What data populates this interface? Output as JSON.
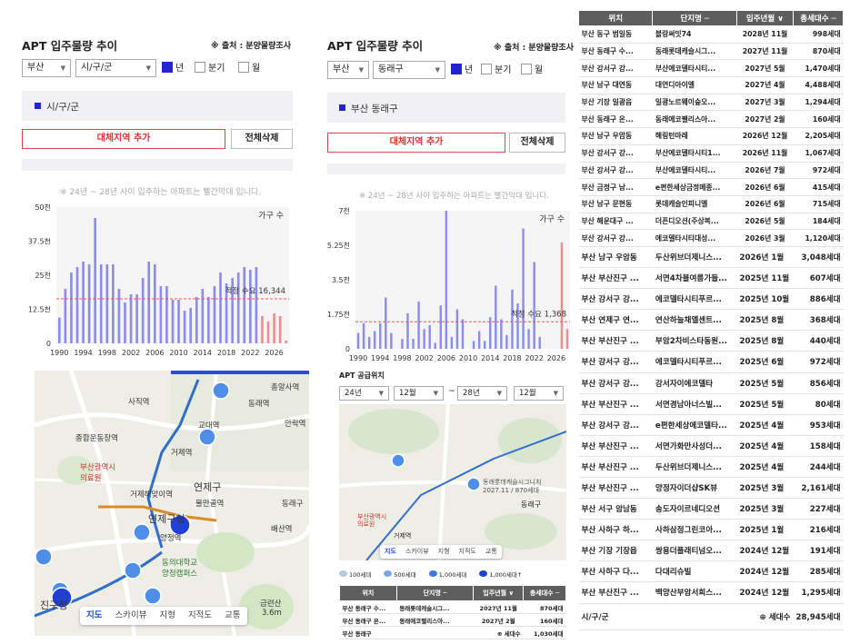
{
  "left": {
    "title": "APT 입주물량 추이",
    "source": "※ 출처 : 분양물량조사",
    "region_select": "부산",
    "district_select": "시/구/군",
    "period": [
      "년",
      "분기",
      "월"
    ],
    "region_label": "시/구/군",
    "add_button": "대체지역 추가",
    "delete_button": "전체삭제",
    "note": "※ 24년 ~ 28년 사이 입주하는 아파트는 빨간막대 입니다.",
    "map": {
      "labels": [
        "사직역",
        "동래역",
        "총알사역",
        "교대역",
        "안락역",
        "종합운동장역",
        "거제역",
        "부산광역시\n의료원",
        "거제해맞이역",
        "연제구",
        "물만골역",
        "동래구",
        "연제구청",
        "배산역",
        "양정역",
        "동의대학교\n양정캠퍼스",
        "진구청",
        "금련산"
      ],
      "tabs": [
        "지도",
        "스카이뷰",
        "지형",
        "지적도",
        "교통"
      ],
      "scale": "3.6m"
    }
  },
  "mid": {
    "title": "APT 입주물량 추이",
    "source": "※ 출처 : 분양물량조사",
    "region_select": "부산",
    "district_select": "동래구",
    "period": [
      "년",
      "분기",
      "월"
    ],
    "region_label": "부산 동래구",
    "add_button": "대체지역 추가",
    "delete_button": "전체삭제",
    "note": "※ 24년 ~ 28년 사이 입주하는 아파트는 빨간막대 입니다.",
    "supply_title": "APT 공급위치",
    "range": {
      "from_year": "24년",
      "from_month": "12월",
      "to_year": "28년",
      "to_month": "12월",
      "sep": "~"
    },
    "map": {
      "popup": "동래롯데캐슬시그니처\n2027.11 / 870세대",
      "labels": [
        "동래구",
        "부산광역시\n의료원",
        "거제역"
      ],
      "tabs": [
        "지도",
        "스카이뷰",
        "지형",
        "지적도",
        "교통"
      ]
    },
    "legend": [
      "100세대",
      "500세대",
      "1,000세대",
      "1,000세대↑"
    ],
    "table": {
      "headers": [
        "위치",
        "단지명 ─",
        "입주년월 ∨",
        "총세대수 ─"
      ],
      "rows": [
        [
          "부산 동래구 수...",
          "동래롯데캐슬시그...",
          "2027년 11월",
          "870세대"
        ],
        [
          "부산 동래구 온...",
          "동래에코팰리스아...",
          "2027년 2월",
          "160세대"
        ]
      ],
      "total": [
        "부산 동래구",
        "",
        "⊕ 세대수",
        "1,030세대"
      ]
    }
  },
  "right": {
    "headers": [
      "위치",
      "단지명 ─",
      "입주년월 ∨",
      "총세대수 ─"
    ],
    "rows": [
      [
        "부산 동구 범일동",
        "블랑써밋74",
        "2028년 11월",
        "998세대"
      ],
      [
        "부산 동래구 수...",
        "동래롯데캐슬시그...",
        "2027년 11월",
        "870세대"
      ],
      [
        "부산 강서구 강...",
        "부산에코델타시티...",
        "2027년 5월",
        "1,470세대"
      ],
      [
        "부산 남구 대연동",
        "대연디아이엘",
        "2027년 4월",
        "4,488세대"
      ],
      [
        "부산 기장 일광읍",
        "일광노르웨이숲오...",
        "2027년 3월",
        "1,294세대"
      ],
      [
        "부산 동래구 온...",
        "동래에코팰리스아...",
        "2027년 2월",
        "160세대"
      ],
      [
        "부산 남구 우암동",
        "해링턴마레",
        "2026년 12월",
        "2,205세대"
      ],
      [
        "부산 강서구 강...",
        "부산에코델타시티1...",
        "2026년 11월",
        "1,067세대"
      ],
      [
        "부산 강서구 강...",
        "부산에코델타시티...",
        "2026년 7월",
        "972세대"
      ],
      [
        "부산 금정구 남...",
        "e편한세상금정메종...",
        "2026년 6월",
        "415세대"
      ],
      [
        "부산 남구 문현동",
        "롯데캐슬인피니엘",
        "2026년 6월",
        "715세대"
      ],
      [
        "부산 해운대구 ...",
        "더픈디오션(주상복...",
        "2026년 5월",
        "184세대"
      ],
      [
        "부산 강서구 강...",
        "에코델타시티대성...",
        "2026년 3월",
        "1,120세대"
      ],
      [
        "부산 남구 우암동",
        "두산위브더제니스...",
        "2026년 1월",
        "3,048세대"
      ],
      [
        "부산 부산진구 ...",
        "서면4차블여름가들...",
        "2025년 11월",
        "607세대"
      ],
      [
        "부산 강서구 강...",
        "에코델타시티푸르...",
        "2025년 10월",
        "886세대"
      ],
      [
        "부산 연제구 연...",
        "연산하늘채엘센트...",
        "2025년 8월",
        "368세대"
      ],
      [
        "부산 부산진구 ...",
        "부암2차비스타동원...",
        "2025년 8월",
        "440세대"
      ],
      [
        "부산 강서구 강...",
        "에코델타시티푸르...",
        "2025년 6월",
        "972세대"
      ],
      [
        "부산 강서구 강...",
        "강서자이에코델타",
        "2025년 5월",
        "856세대"
      ],
      [
        "부산 부산진구 ...",
        "서면경남아너스빌...",
        "2025년 5월",
        "80세대"
      ],
      [
        "부산 강서구 강...",
        "e편한세상에코델타...",
        "2025년 4월",
        "953세대"
      ],
      [
        "부산 부산진구 ...",
        "서면가화만사성더...",
        "2025년 4월",
        "158세대"
      ],
      [
        "부산 부산진구 ...",
        "두산위브더제니스...",
        "2025년 4월",
        "244세대"
      ],
      [
        "부산 부산진구 ...",
        "양정자이더샵SK뷰",
        "2025년 3월",
        "2,161세대"
      ],
      [
        "부산 서구 암남동",
        "송도자이르네디오션",
        "2025년 3월",
        "227세대"
      ],
      [
        "부산 사하구 하...",
        "사하삼정그린코아...",
        "2025년 1월",
        "216세대"
      ],
      [
        "부산 기장 기장읍",
        "쌍용더플래티넘오...",
        "2024년 12월",
        "191세대"
      ],
      [
        "부산 사하구 다...",
        "다대리슈빌",
        "2024년 12월",
        "285세대"
      ],
      [
        "부산 부산진구 ...",
        "백양산부암서희스...",
        "2024년 12월",
        "1,295세대"
      ]
    ],
    "total": [
      "시/구/군",
      "",
      "⊕ 세대수",
      "28,945세대"
    ]
  },
  "chart_data": [
    {
      "type": "bar",
      "title": "",
      "xlabel": "",
      "ylabel": "",
      "unit_label": "가구 수",
      "ylim": [
        0,
        50000
      ],
      "yticks": [
        "0",
        "12.5천",
        "25천",
        "37.5천",
        "50천"
      ],
      "xticks": [
        "1990",
        "1994",
        "1998",
        "2002",
        "2006",
        "2010",
        "2014",
        "2018",
        "2022",
        "2026"
      ],
      "categories": [
        1990,
        1991,
        1992,
        1993,
        1994,
        1995,
        1996,
        1997,
        1998,
        1999,
        2000,
        2001,
        2002,
        2003,
        2004,
        2005,
        2006,
        2007,
        2008,
        2009,
        2010,
        2011,
        2012,
        2013,
        2014,
        2015,
        2016,
        2017,
        2018,
        2019,
        2020,
        2021,
        2022,
        2023,
        2024,
        2025,
        2026,
        2027,
        2028
      ],
      "values": [
        9500,
        20000,
        26000,
        28000,
        30000,
        29000,
        46000,
        29000,
        29000,
        29000,
        20000,
        15000,
        18000,
        18000,
        24000,
        30000,
        29000,
        21000,
        21000,
        16000,
        16000,
        12000,
        13000,
        17000,
        20000,
        17000,
        21000,
        26000,
        22000,
        24000,
        26000,
        28000,
        27000,
        28000,
        10000,
        8000,
        11000,
        10000,
        1000
      ],
      "highlight_from": 2024,
      "reference_line": {
        "label": "적정 수요 16,344",
        "value": 16344
      }
    },
    {
      "type": "bar",
      "title": "",
      "xlabel": "",
      "ylabel": "",
      "unit_label": "가구 수",
      "ylim": [
        0,
        7000
      ],
      "yticks": [
        "0",
        "1.75천",
        "3.5천",
        "5.25천",
        "7천"
      ],
      "xticks": [
        "1990",
        "1994",
        "1998",
        "2002",
        "2006",
        "2010",
        "2014",
        "2018",
        "2022",
        "2026"
      ],
      "categories": [
        1990,
        1991,
        1992,
        1993,
        1994,
        1995,
        1996,
        1997,
        1998,
        1999,
        2000,
        2001,
        2002,
        2003,
        2004,
        2005,
        2006,
        2007,
        2008,
        2009,
        2010,
        2011,
        2012,
        2013,
        2014,
        2015,
        2016,
        2017,
        2018,
        2019,
        2020,
        2021,
        2022,
        2023,
        2024,
        2025,
        2026,
        2027,
        2028
      ],
      "values": [
        800,
        1300,
        600,
        900,
        1300,
        2600,
        800,
        0,
        500,
        1800,
        500,
        2400,
        1000,
        1200,
        300,
        2200,
        7000,
        600,
        2000,
        1500,
        0,
        400,
        900,
        400,
        1600,
        3200,
        1500,
        700,
        3000,
        2300,
        6100,
        1000,
        4400,
        600,
        0,
        0,
        0,
        5400,
        1000
      ],
      "highlight_from": 2024,
      "reference_line": {
        "label": "적정 수요 1,368",
        "value": 1368
      }
    }
  ]
}
